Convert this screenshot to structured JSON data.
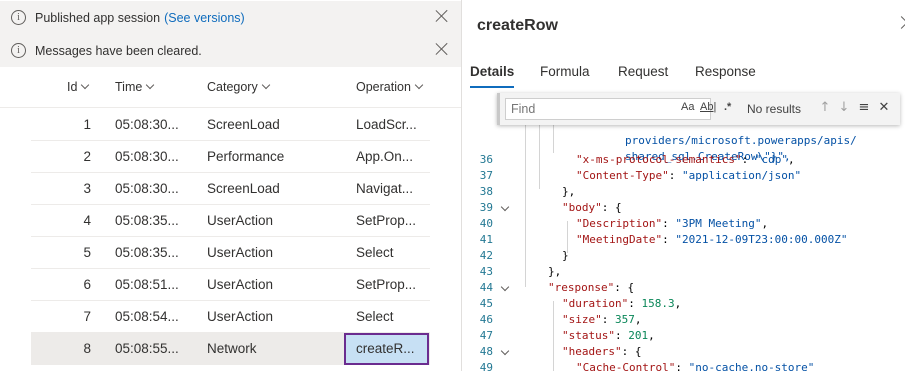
{
  "banners": [
    {
      "message": "Published app session",
      "link": "(See versions)"
    },
    {
      "message": "Messages have been cleared.",
      "link": ""
    }
  ],
  "table": {
    "columns": [
      "Id",
      "Time",
      "Category",
      "Operation"
    ],
    "rows": [
      {
        "id": "1",
        "time": "05:08:30...",
        "category": "ScreenLoad",
        "operation": "LoadScr..."
      },
      {
        "id": "2",
        "time": "05:08:30...",
        "category": "Performance",
        "operation": "App.On..."
      },
      {
        "id": "3",
        "time": "05:08:30...",
        "category": "ScreenLoad",
        "operation": "Navigat..."
      },
      {
        "id": "4",
        "time": "05:08:35...",
        "category": "UserAction",
        "operation": "SetProp..."
      },
      {
        "id": "5",
        "time": "05:08:35...",
        "category": "UserAction",
        "operation": "Select"
      },
      {
        "id": "6",
        "time": "05:08:51...",
        "category": "UserAction",
        "operation": "SetProp..."
      },
      {
        "id": "7",
        "time": "05:08:54...",
        "category": "UserAction",
        "operation": "Select"
      },
      {
        "id": "8",
        "time": "05:08:55...",
        "category": "Network",
        "operation": "createR..."
      }
    ],
    "selected_row_id": "8"
  },
  "panel": {
    "title": "createRow",
    "tabs": [
      "Details",
      "Formula",
      "Request",
      "Response"
    ],
    "active_tab": "Details"
  },
  "find": {
    "placeholder": "Find",
    "match_case": "Aa",
    "whole_word": "Ab|",
    "regex": ".*",
    "result": "No results"
  },
  "code": {
    "partial_lines": [
      "providers/microsoft.powerapps/apis/",
      "shared_sql.CreateRow\\\"}\","
    ],
    "lines": [
      {
        "n": "36",
        "text": "\"x-ms-protocol-semantics\": \"cdp\","
      },
      {
        "n": "37",
        "text": "\"Content-Type\": \"application/json\""
      },
      {
        "n": "38",
        "text": "},"
      },
      {
        "n": "39",
        "text": "\"body\": {"
      },
      {
        "n": "40",
        "text": "\"Description\": \"3PM Meeting\","
      },
      {
        "n": "41",
        "text": "\"MeetingDate\": \"2021-12-09T23:00:00.000Z\""
      },
      {
        "n": "42",
        "text": "}"
      },
      {
        "n": "43",
        "text": "},"
      },
      {
        "n": "44",
        "text": "\"response\": {"
      },
      {
        "n": "45",
        "text": "\"duration\": 158.3,"
      },
      {
        "n": "46",
        "text": "\"size\": 357,"
      },
      {
        "n": "47",
        "text": "\"status\": 201,"
      },
      {
        "n": "48",
        "text": "\"headers\": {"
      },
      {
        "n": "49",
        "text": "\"Cache-Control\": \"no-cache,no-store\""
      }
    ]
  },
  "colors": {
    "accent": "#0f6cbd",
    "selected_cell_bg": "#c7e0f4",
    "selected_cell_border": "#6b2c8f",
    "json_key": "#a31515",
    "json_string": "#0451a5",
    "json_number": "#098658",
    "line_number": "#237893"
  },
  "icons": [
    "info-icon",
    "close-icon",
    "chevron-down-icon",
    "chevron-right-icon",
    "arrow-up-icon",
    "arrow-down-icon",
    "selection-icon"
  ]
}
